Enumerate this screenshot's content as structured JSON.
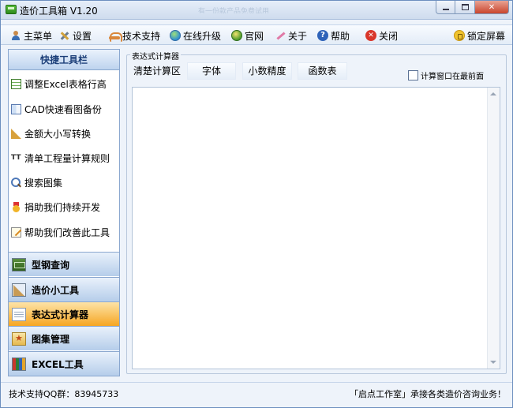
{
  "window": {
    "title": "造价工具箱 V1.20",
    "title_hint": "有一份款产品免费试用"
  },
  "toolbar": {
    "main_menu": "主菜单",
    "settings": "设置",
    "tech_support": "技术支持",
    "online_upgrade": "在线升级",
    "website": "官网",
    "about": "关于",
    "help": "帮助",
    "close": "关闭",
    "lock_screen": "锁定屏幕"
  },
  "sidebar": {
    "header": "快捷工具栏",
    "items": [
      {
        "label": "调整Excel表格行高",
        "icon": "table-icon"
      },
      {
        "label": "CAD快速看图备份",
        "icon": "cad-icon"
      },
      {
        "label": "金额大小写转换",
        "icon": "ruler-icon"
      },
      {
        "label": "清单工程量计算规则",
        "icon": "tt-icon"
      },
      {
        "label": "搜索图集",
        "icon": "search-icon"
      },
      {
        "label": "捐助我们持续开发",
        "icon": "medal-icon"
      },
      {
        "label": "帮助我们改善此工具",
        "icon": "note-icon"
      }
    ],
    "sections": [
      {
        "label": "型钢查询",
        "active": false
      },
      {
        "label": "造价小工具",
        "active": false
      },
      {
        "label": "表达式计算器",
        "active": true
      },
      {
        "label": "图集管理",
        "active": false
      },
      {
        "label": "EXCEL工具",
        "active": false
      }
    ]
  },
  "calculator": {
    "group_title": "表达式计算器",
    "tabs": [
      "清楚计算区",
      "字体",
      "小数精度",
      "函数表"
    ],
    "always_on_top_label": "计算窗口在最前面",
    "always_on_top_checked": false,
    "expression_text": ""
  },
  "statusbar": {
    "left": "技术支持QQ群：83945733",
    "right": "「启点工作室」承接各类造价咨询业务！"
  },
  "colors": {
    "accent": "#f6a623",
    "panel_border": "#8aa7cf",
    "header_text": "#1c3f79"
  }
}
